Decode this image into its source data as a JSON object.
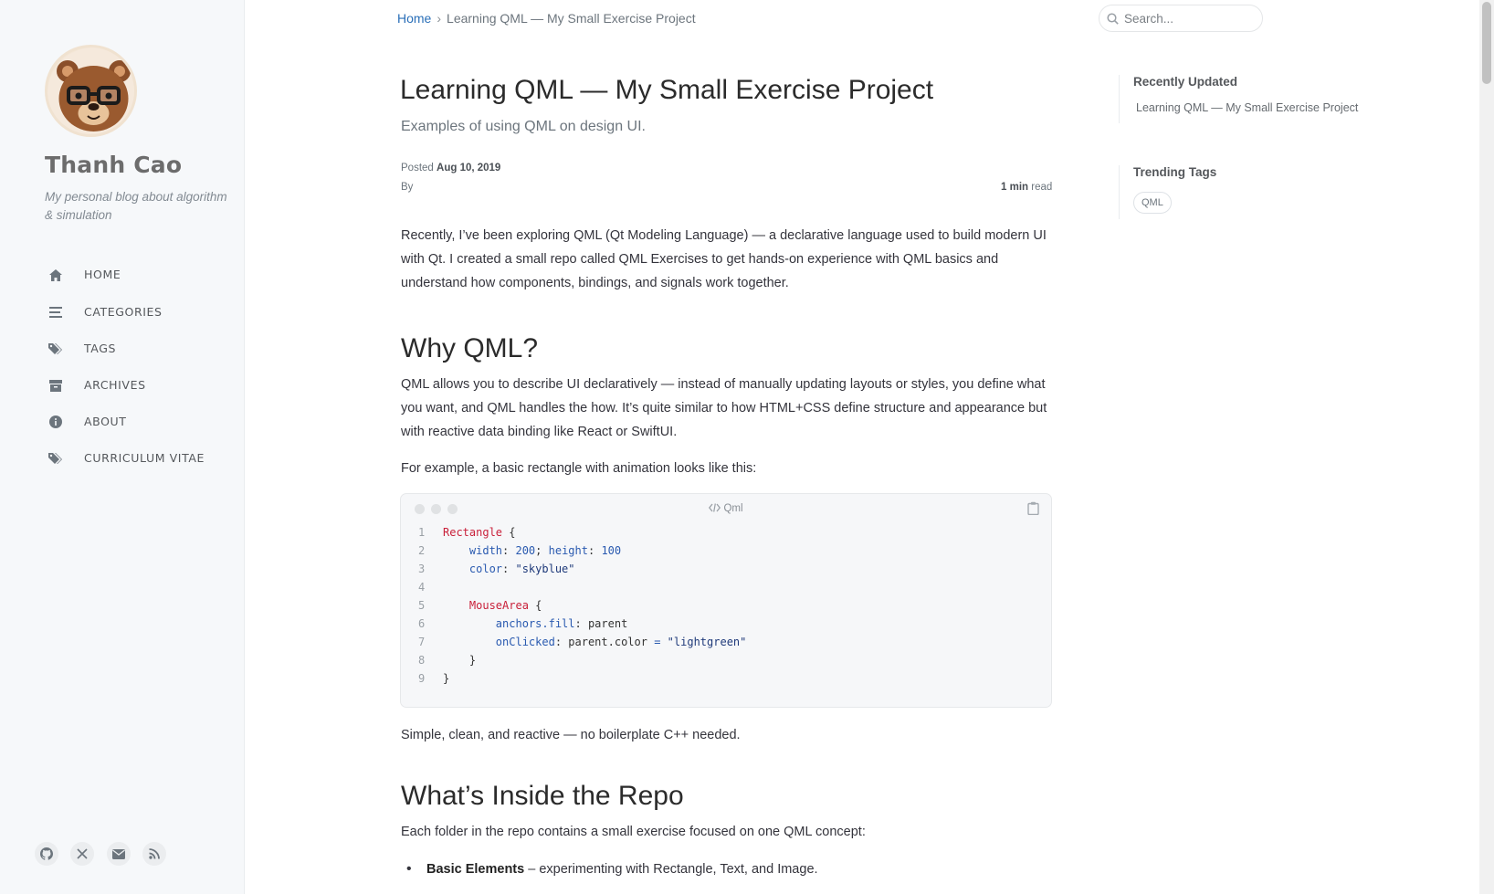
{
  "sidebar": {
    "site_title": "Thanh Cao",
    "site_subtitle": "My personal blog about algorithm & simulation",
    "nav": [
      {
        "label": "HOME",
        "icon": "home-icon"
      },
      {
        "label": "CATEGORIES",
        "icon": "stream-icon"
      },
      {
        "label": "TAGS",
        "icon": "tags-icon"
      },
      {
        "label": "ARCHIVES",
        "icon": "archive-icon"
      },
      {
        "label": "ABOUT",
        "icon": "info-circle-icon"
      },
      {
        "label": "CURRICULUM VITAE",
        "icon": "tags-icon"
      }
    ],
    "social": [
      "github-icon",
      "x-twitter-icon",
      "envelope-icon",
      "rss-icon"
    ]
  },
  "topbar": {
    "breadcrumb_home": "Home",
    "breadcrumb_current": "Learning QML — My Small Exercise Project",
    "search_placeholder": "Search..."
  },
  "post": {
    "title": "Learning QML — My Small Exercise Project",
    "subtitle": "Examples of using QML on design UI.",
    "posted_label": "Posted",
    "posted_date": "Aug 10, 2019",
    "by_label": "By",
    "read_time": "1 min",
    "read_label": "read",
    "intro": "Recently, I’ve been exploring QML (Qt Modeling Language) — a declarative language used to build modern UI with Qt. I created a small repo called QML Exercises to get hands-on experience with QML basics and understand how components, bindings, and signals work together.",
    "h_why": "Why QML?",
    "why_para": "QML allows you to describe UI declaratively — instead of manually updating layouts or styles, you define what you want, and QML handles the how. It’s quite similar to how HTML+CSS define structure and appearance but with reactive data binding like React or SwiftUI.",
    "example_para": "For example, a basic rectangle with animation looks like this:",
    "code_lang": "Qml",
    "code_lines": [
      "Rectangle {",
      "    width: 200; height: 100",
      "    color: \"skyblue\"",
      "",
      "    MouseArea {",
      "        anchors.fill: parent",
      "        onClicked: parent.color = \"lightgreen\"",
      "    }",
      "}"
    ],
    "after_code": "Simple, clean, and reactive — no boilerplate C++ needed.",
    "h_repo": "What’s Inside the Repo",
    "repo_para": "Each folder in the repo contains a small exercise focused on one QML concept:",
    "list": [
      {
        "bold": "Basic Elements",
        "text": " – experimenting with Rectangle, Text, and Image."
      }
    ]
  },
  "panel": {
    "recent_heading": "Recently Updated",
    "recent_items": [
      "Learning QML — My Small Exercise Project"
    ],
    "tags_heading": "Trending Tags",
    "tags": [
      "QML"
    ]
  },
  "colors": {
    "link": "#2a6fb8",
    "sidebar_bg": "#f6f8fa",
    "code_type": "#c9203a",
    "code_prop": "#2a5ab0"
  }
}
